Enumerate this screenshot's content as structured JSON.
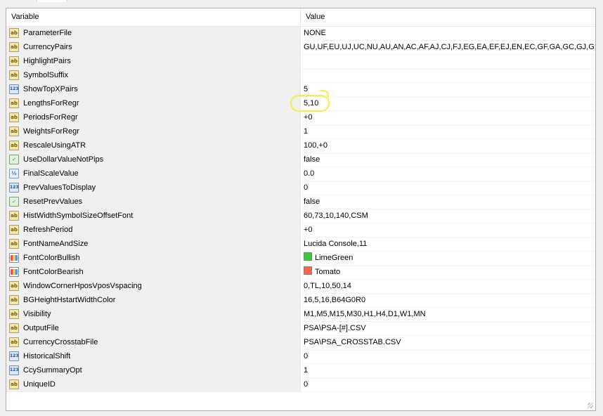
{
  "header": {
    "variable_label": "Variable",
    "value_label": "Value"
  },
  "rows": [
    {
      "name": "ParameterFile",
      "value": "NONE",
      "icon": "string-icon"
    },
    {
      "name": "CurrencyPairs",
      "value": "GU,UF,EU,UJ,UC,NU,AU,AN,AC,AF,AJ,CJ,FJ,EG,EA,EF,EJ,EN,EC,GF,GA,GC,GJ,G...",
      "icon": "string-icon"
    },
    {
      "name": "HighlightPairs",
      "value": "",
      "icon": "string-icon"
    },
    {
      "name": "SymbolSuffix",
      "value": "",
      "icon": "string-icon"
    },
    {
      "name": "ShowTopXPairs",
      "value": "5",
      "icon": "integer-icon"
    },
    {
      "name": "LengthsForRegr",
      "value": "5,10",
      "icon": "string-icon"
    },
    {
      "name": "PeriodsForRegr",
      "value": "+0",
      "icon": "string-icon"
    },
    {
      "name": "WeightsForRegr",
      "value": "1",
      "icon": "string-icon"
    },
    {
      "name": "RescaleUsingATR",
      "value": "100,+0",
      "icon": "string-icon"
    },
    {
      "name": "UseDollarValueNotPips",
      "value": "false",
      "icon": "boolean-icon"
    },
    {
      "name": "FinalScaleValue",
      "value": "0.0",
      "icon": "double-icon"
    },
    {
      "name": "PrevValuesToDisplay",
      "value": "0",
      "icon": "integer-icon"
    },
    {
      "name": "ResetPrevValues",
      "value": "false",
      "icon": "boolean-icon"
    },
    {
      "name": "HistWidthSymbolSizeOffsetFont",
      "value": "60,73,10,140,CSM",
      "icon": "string-icon"
    },
    {
      "name": "RefreshPeriod",
      "value": "+0",
      "icon": "string-icon"
    },
    {
      "name": "FontNameAndSize",
      "value": "Lucida Console,11",
      "icon": "string-icon"
    },
    {
      "name": "FontColorBullish",
      "value": "LimeGreen",
      "icon": "color-icon",
      "swatch": "#32cd32"
    },
    {
      "name": "FontColorBearish",
      "value": "Tomato",
      "icon": "color-icon",
      "swatch": "#ff6347"
    },
    {
      "name": "WindowCornerHposVposVspacing",
      "value": "0,TL,10,50,14",
      "icon": "string-icon"
    },
    {
      "name": "BGHeightHstartWidthColor",
      "value": "16,5,16,B64G0R0",
      "icon": "string-icon"
    },
    {
      "name": "Visibility",
      "value": "M1,M5,M15,M30,H1,H4,D1,W1,MN",
      "icon": "string-icon"
    },
    {
      "name": "OutputFile",
      "value": "PSA\\PSA-[#].CSV",
      "icon": "string-icon"
    },
    {
      "name": "CurrencyCrosstabFile",
      "value": "PSA\\PSA_CROSSTAB.CSV",
      "icon": "string-icon"
    },
    {
      "name": "HistoricalShift",
      "value": "0",
      "icon": "integer-icon"
    },
    {
      "name": "CcySummaryOpt",
      "value": "1",
      "icon": "integer-icon"
    },
    {
      "name": "UniqueID",
      "value": "0",
      "icon": "string-icon"
    }
  ],
  "icon_glyphs": {
    "string-icon": "ab",
    "integer-icon": "123",
    "boolean-icon": "✓",
    "double-icon": "½",
    "color-icon": ""
  },
  "colors": {
    "highlight_circle": "#f3f03a"
  }
}
